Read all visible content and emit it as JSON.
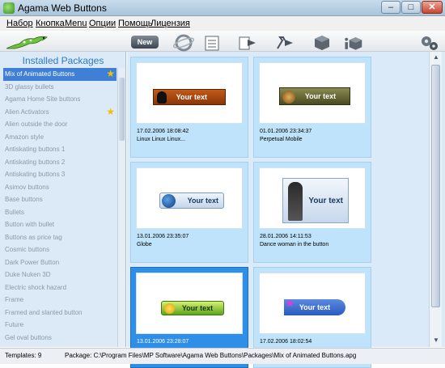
{
  "window": {
    "title": "Agama Web Buttons"
  },
  "menu": [
    "Набор",
    "Кнопка",
    "Menu",
    "Опции",
    "Помощь",
    "Лицензия"
  ],
  "toolbar": {
    "new_label": "New"
  },
  "left_panel": {
    "title": "Installed Packages",
    "items": [
      "Mix of Animated Buttons",
      "3D glassy bullets",
      "Agama Home Site buttons",
      "Alien Activators",
      "Alien outside the door",
      "Amazon style",
      "Antiskating buttons 1",
      "Antiskating buttons 2",
      "Antiskating buttons 3",
      "Asimov buttons",
      "Base buttons",
      "Bullets",
      "Button with bullet",
      "Buttons as price tag",
      "Cosmic buttons",
      "Dark Power Button",
      "Duke Nuken 3D",
      "Electric shock hazard",
      "Frame",
      "Framed and slanted button",
      "Future",
      "Gel oval buttons"
    ]
  },
  "cards": [
    {
      "date": "17.02.2006 18:08:42",
      "name": "Linux Linux Linux...",
      "button_text": "Your text"
    },
    {
      "date": "01.01.2006 23:34:37",
      "name": "Perpetual Mobile",
      "button_text": "Your text"
    },
    {
      "date": "13.01.2006 23:35:07",
      "name": "Globe",
      "button_text": "Your text"
    },
    {
      "date": "28.01.2006 14:11:53",
      "name": "Dance woman in the button",
      "button_text": "Your text"
    },
    {
      "date": "13.01.2006 23:28:07",
      "name": "",
      "button_text": "Your text"
    },
    {
      "date": "17.02.2006 18:02:54",
      "name": "",
      "button_text": "Your text"
    }
  ],
  "status": {
    "templates": "Templates: 9",
    "path": "Package: C:\\Program Files\\MP Software\\Agama Web Buttons\\Packages\\Mix of Animated Buttons.apg"
  },
  "colors": {
    "accent": "#2a7cc7",
    "selection": "#3f7fd6",
    "card_bg": "#bfe3fa"
  }
}
